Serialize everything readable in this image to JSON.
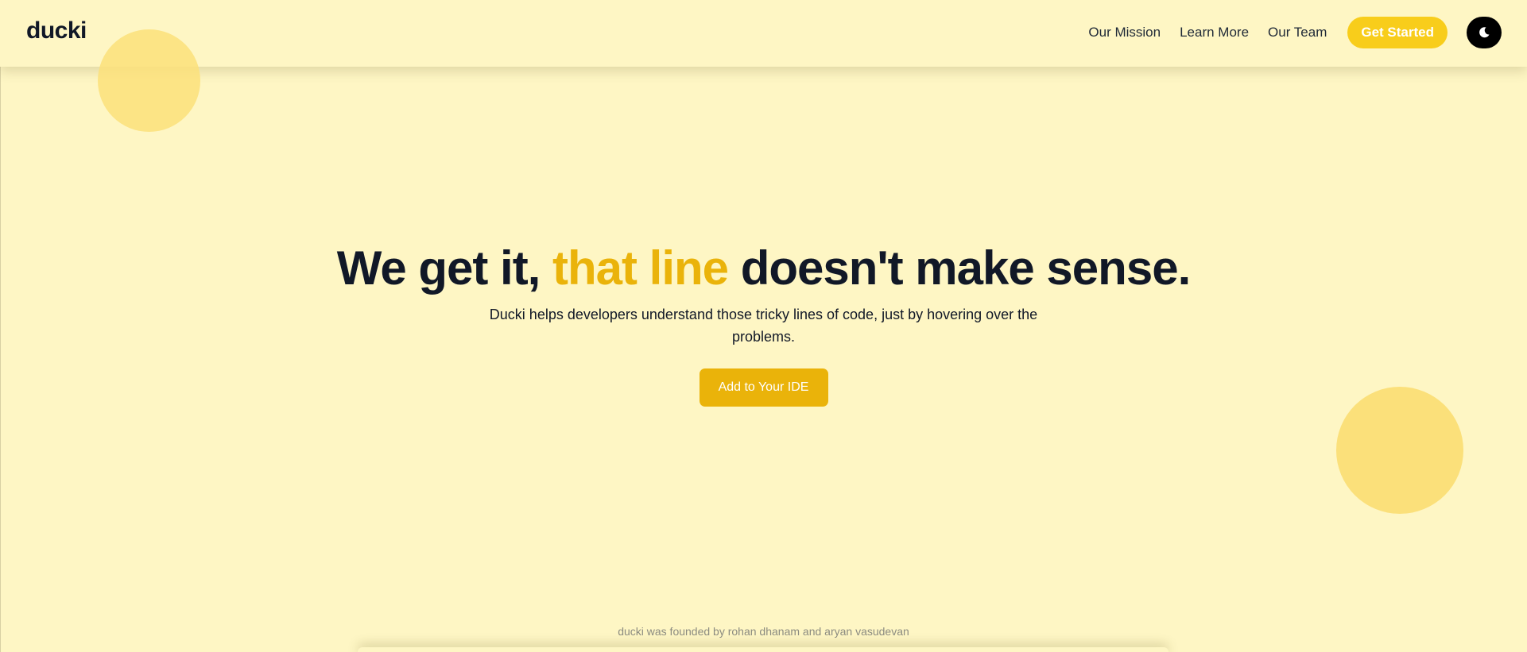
{
  "header": {
    "logo": "ducki",
    "nav": {
      "mission": "Our Mission",
      "learn": "Learn More",
      "team": "Our Team"
    },
    "cta_label": "Get Started",
    "theme_toggle_icon": "moon-icon"
  },
  "hero": {
    "headline_start": "We get it, ",
    "headline_accent": "that line",
    "headline_end": " doesn't make sense.",
    "subtitle": "Ducki helps developers understand those tricky lines of code, just by hovering over the problems.",
    "button_label": "Add to Your IDE"
  },
  "footer": {
    "credit": "ducki was founded by rohan dhanam and aryan vasudevan"
  },
  "colors": {
    "background": "#fef6c4",
    "accent": "#eab30a",
    "cta": "#f8cd1b",
    "circle": "#fbe07a",
    "text": "#111827"
  }
}
